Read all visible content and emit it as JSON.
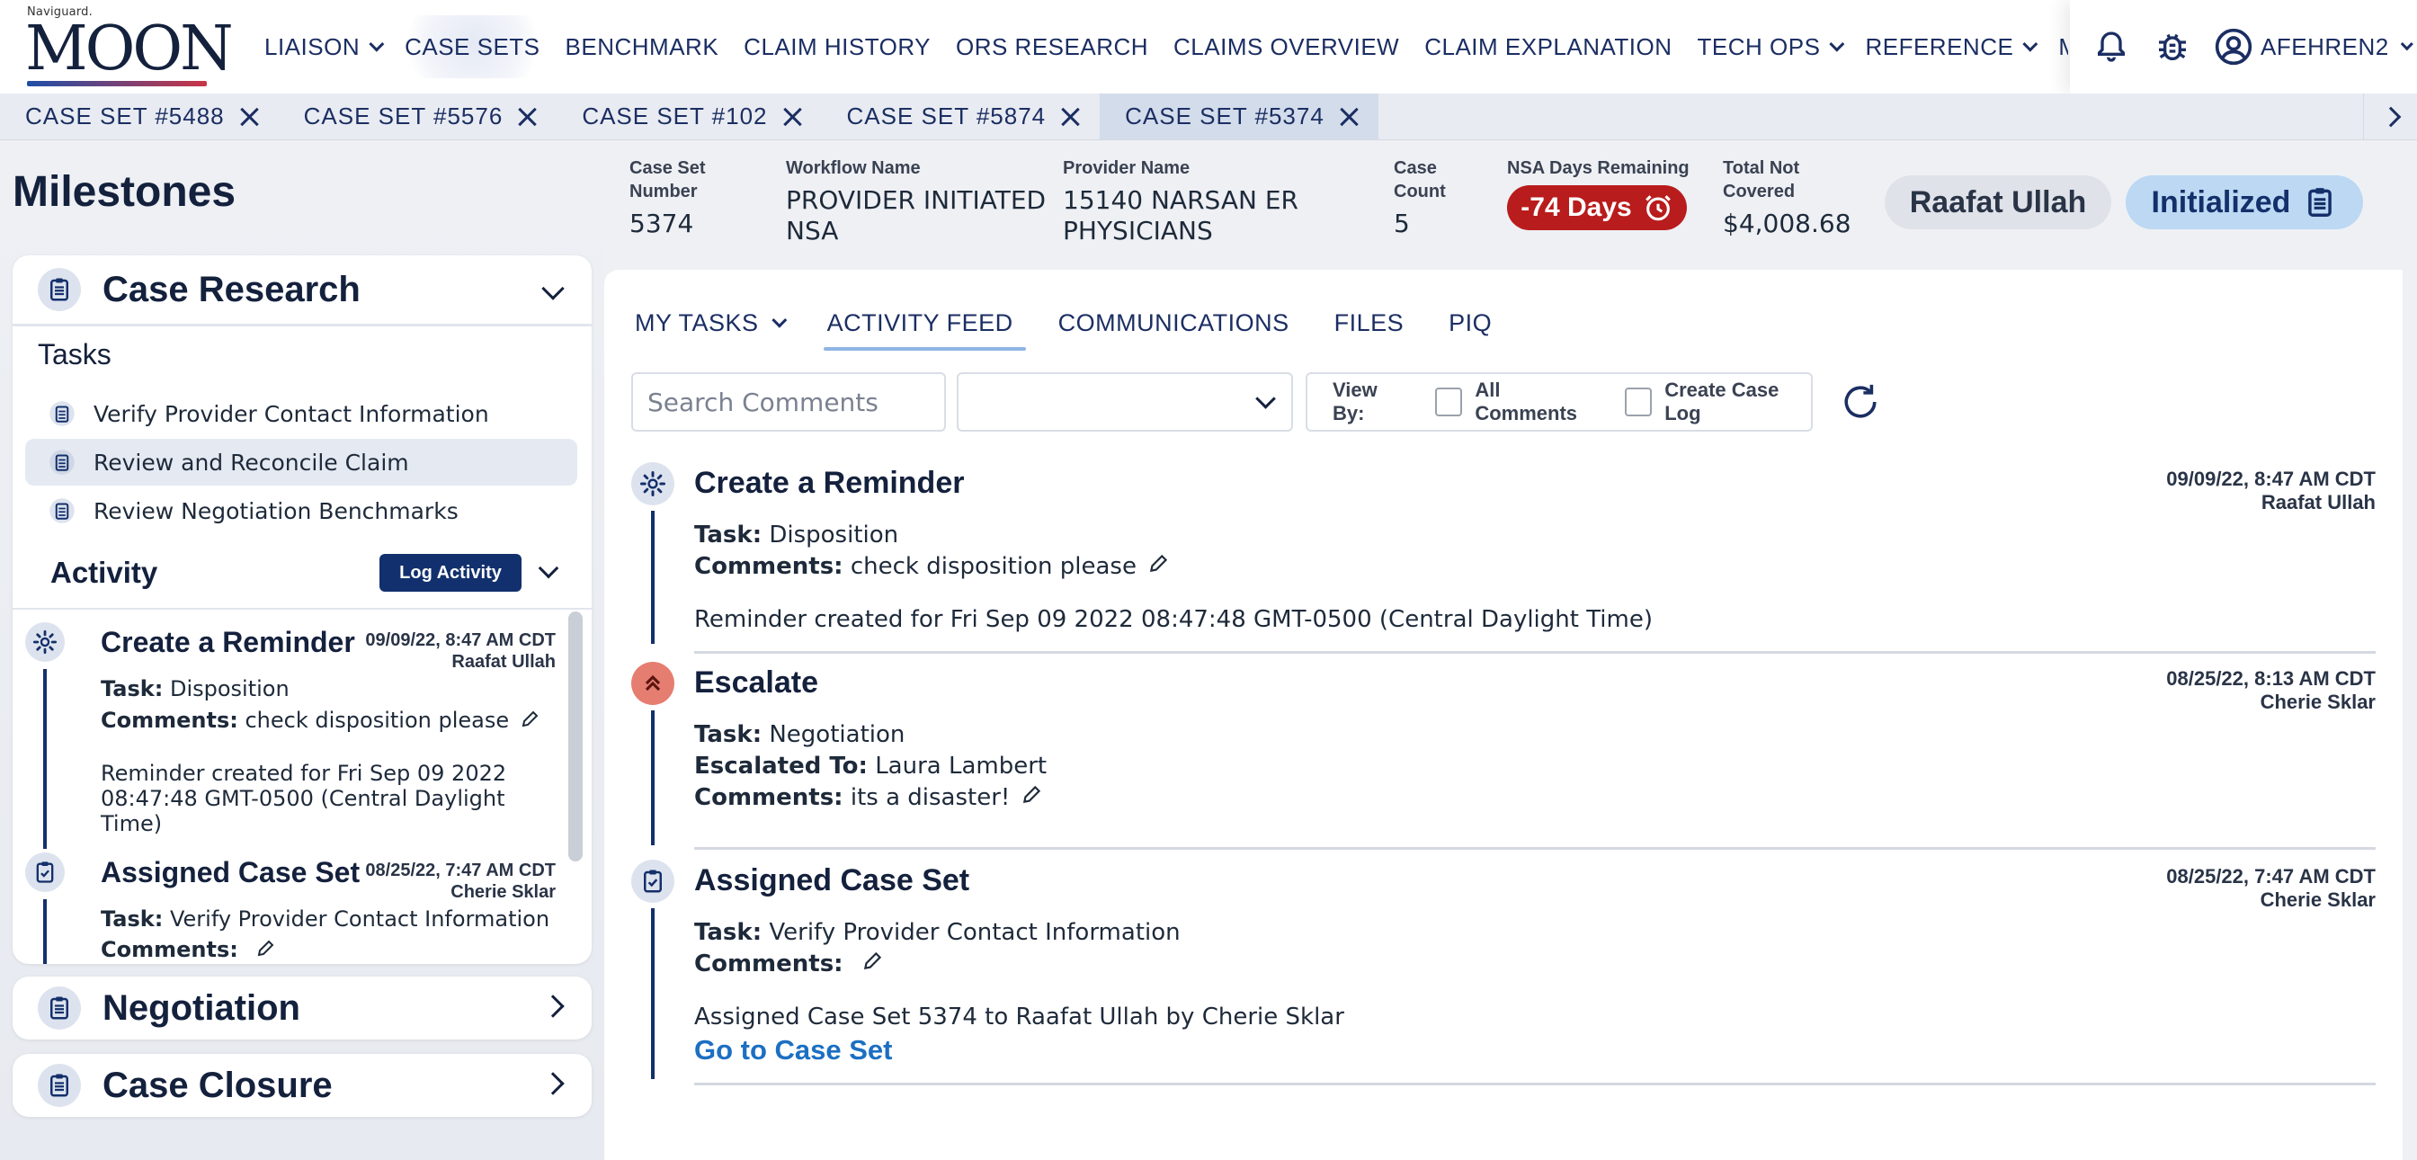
{
  "brand": {
    "small": "Naviguard.",
    "name": "MOON"
  },
  "nav": {
    "items": [
      {
        "label": "LIAISON",
        "dropdown": true
      },
      {
        "label": "CASE SETS",
        "dropdown": false,
        "active": true
      },
      {
        "label": "BENCHMARK",
        "dropdown": false
      },
      {
        "label": "CLAIM HISTORY",
        "dropdown": false
      },
      {
        "label": "ORS RESEARCH",
        "dropdown": false
      },
      {
        "label": "CLAIMS OVERVIEW",
        "dropdown": false
      },
      {
        "label": "CLAIM EXPLANATION",
        "dropdown": false
      },
      {
        "label": "TECH OPS",
        "dropdown": true
      },
      {
        "label": "REFERENCE",
        "dropdown": true
      },
      {
        "label": "MEMBERS OF INTEREST",
        "dropdown": false
      }
    ],
    "user": "AFEHREN2",
    "icons": [
      "bell-icon",
      "bug-icon",
      "user-circle-icon"
    ]
  },
  "case_tabs": [
    {
      "label": "CASE SET #5488"
    },
    {
      "label": "CASE SET #5576"
    },
    {
      "label": "CASE SET #102"
    },
    {
      "label": "CASE SET #5874"
    },
    {
      "label": "CASE SET #5374",
      "active": true
    }
  ],
  "milestones": {
    "title": "Milestones",
    "case_research": {
      "title": "Case Research",
      "tasks_label": "Tasks",
      "tasks": [
        "Verify Provider Contact Information",
        "Review and Reconcile Claim",
        "Review Negotiation Benchmarks"
      ],
      "activity_label": "Activity",
      "log_button": "Log Activity",
      "activity": [
        {
          "title": "Create a Reminder",
          "date": "09/09/22, 8:47 AM CDT",
          "user": "Raafat Ullah",
          "task_label": "Task:",
          "task": "Disposition",
          "comments_label": "Comments:",
          "comments": "check disposition please",
          "note_line1": "Reminder created for Fri Sep 09 2022",
          "note_line2": "08:47:48 GMT-0500 (Central Daylight Time)"
        },
        {
          "title": "Assigned Case Set",
          "date": "08/25/22, 7:47 AM CDT",
          "user": "Cherie Sklar",
          "task_label": "Task:",
          "task": "Verify Provider Contact Information",
          "comments_label": "Comments:",
          "comments": ""
        }
      ]
    },
    "negotiation": {
      "title": "Negotiation"
    },
    "case_closure": {
      "title": "Case Closure"
    }
  },
  "case_info": {
    "case_set_number_label1": "Case Set",
    "case_set_number_label2": "Number",
    "case_set_number": "5374",
    "workflow_label": "Workflow Name",
    "workflow_line1": "PROVIDER INITIATED",
    "workflow_line2": "NSA",
    "provider_label": "Provider Name",
    "provider_line1": "15140 NARSAN ER",
    "provider_line2": "PHYSICIANS",
    "case_count_label1": "Case",
    "case_count_label2": "Count",
    "case_count": "5",
    "nsa_label": "NSA Days Remaining",
    "nsa_days": "-74 Days",
    "total_label1": "Total Not",
    "total_label2": "Covered",
    "total_value": "$4,008.68",
    "assignee": "Raafat Ullah",
    "status": "Initialized"
  },
  "subtabs": [
    {
      "label": "MY TASKS",
      "dropdown": true
    },
    {
      "label": "ACTIVITY FEED",
      "active": true
    },
    {
      "label": "COMMUNICATIONS"
    },
    {
      "label": "FILES"
    },
    {
      "label": "PIQ"
    }
  ],
  "filters": {
    "search_placeholder": "Search Comments",
    "view_by_label": "View By:",
    "all_comments": "All Comments",
    "create_case_log": "Create Case Log"
  },
  "feed": [
    {
      "title": "Create a Reminder",
      "date": "09/09/22, 8:47 AM CDT",
      "user": "Raafat Ullah",
      "icon": "gear-icon",
      "task_label": "Task:",
      "task": "Disposition",
      "comments_label": "Comments:",
      "comments": "check disposition please",
      "note": "Reminder created for Fri Sep 09 2022 08:47:48 GMT-0500 (Central Daylight Time)"
    },
    {
      "title": "Escalate",
      "date": "08/25/22, 8:13 AM CDT",
      "user": "Cherie Sklar",
      "icon": "escalate-icon",
      "task_label": "Task:",
      "task": "Negotiation",
      "escalated_label": "Escalated To:",
      "escalated_to": "Laura Lambert",
      "comments_label": "Comments:",
      "comments": "its a disaster!"
    },
    {
      "title": "Assigned Case Set",
      "date": "08/25/22, 7:47 AM CDT",
      "user": "Cherie Sklar",
      "icon": "clipboard-check-icon",
      "task_label": "Task:",
      "task": "Verify Provider Contact Information",
      "comments_label": "Comments:",
      "comments": "",
      "note": "Assigned Case Set 5374 to Raafat Ullah by Cherie Sklar",
      "link": "Go to Case Set"
    }
  ]
}
